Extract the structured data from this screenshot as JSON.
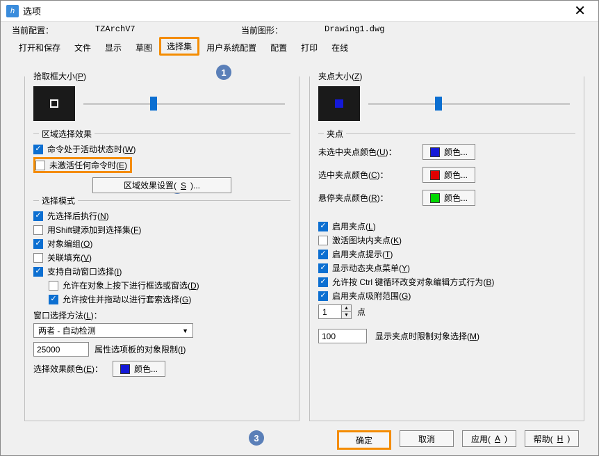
{
  "window": {
    "title": "选项"
  },
  "header": {
    "config_label": "当前配置：",
    "config_value": "TZArchV7",
    "drawing_label": "当前图形：",
    "drawing_value": "Drawing1.dwg"
  },
  "tabs": {
    "items": [
      "打开和保存",
      "文件",
      "显示",
      "草图",
      "选择集",
      "用户系统配置",
      "配置",
      "打印",
      "在线"
    ],
    "active_index": 4
  },
  "left": {
    "pickbox": {
      "title": "拾取框大小(P)",
      "slider_pos_pct": 33
    },
    "area_effect": {
      "title": "区域选择效果",
      "active_cmd": "命令处于活动状态时(W)",
      "active_cmd_checked": true,
      "no_cmd": "未激活任何命令时(E)",
      "no_cmd_checked": false,
      "settings_btn": "区域效果设置(S)..."
    },
    "sel_mode": {
      "title": "选择模式",
      "pre_exec": "先选择后执行(N)",
      "pre_exec_checked": true,
      "shift_add": "用Shift键添加到选择集(F)",
      "shift_add_checked": false,
      "obj_group": "对象编组(O)",
      "obj_group_checked": true,
      "assoc_hatch": "关联填充(V)",
      "assoc_hatch_checked": false,
      "auto_window": "支持自动窗口选择(I)",
      "auto_window_checked": true,
      "press_drag": "允许在对象上按下进行框选或窗选(D)",
      "press_drag_checked": false,
      "hold_drag": "允许按住并拖动以进行套索选择(G)",
      "hold_drag_checked": true,
      "window_method_label": "窗口选择方法(L)：",
      "window_method_value": "两者 - 自动检测",
      "prop_limit_value": "25000",
      "prop_limit_label": "属性选项板的对象限制(I)",
      "color_label": "选择效果颜色(E)：",
      "color_btn": "颜色...",
      "color_swatch": "#1419d8"
    }
  },
  "right": {
    "gripsize": {
      "title": "夹点大小(Z)",
      "slider_pos_pct": 33
    },
    "grip_colors": {
      "title": "夹点",
      "unsel_label": "未选中夹点颜色(U)：",
      "unsel_swatch": "#1419d8",
      "sel_label": "选中夹点颜色(C)：",
      "sel_swatch": "#e00000",
      "hover_label": "悬停夹点颜色(R)：",
      "hover_swatch": "#00d800",
      "btn": "颜色..."
    },
    "grip_opts": {
      "enable": "启用夹点(L)",
      "enable_checked": true,
      "block": "激活图块内夹点(K)",
      "block_checked": false,
      "hint": "启用夹点提示(T)",
      "hint_checked": true,
      "menu": "显示动态夹点菜单(Y)",
      "menu_checked": true,
      "ctrl": "允许按 Ctrl 键循环改变对象编辑方式行为(B)",
      "ctrl_checked": true,
      "snap": "启用夹点吸附范围(G)",
      "snap_checked": true,
      "spin_val": "1",
      "spin_label": "点",
      "limit_val": "100",
      "limit_label": "显示夹点时限制对象选择(M)"
    }
  },
  "footer": {
    "ok": "确定",
    "cancel": "取消",
    "apply": "应用(A)",
    "help": "帮助(H)"
  },
  "callouts": {
    "c1": "1",
    "c2": "2",
    "c3": "3"
  }
}
